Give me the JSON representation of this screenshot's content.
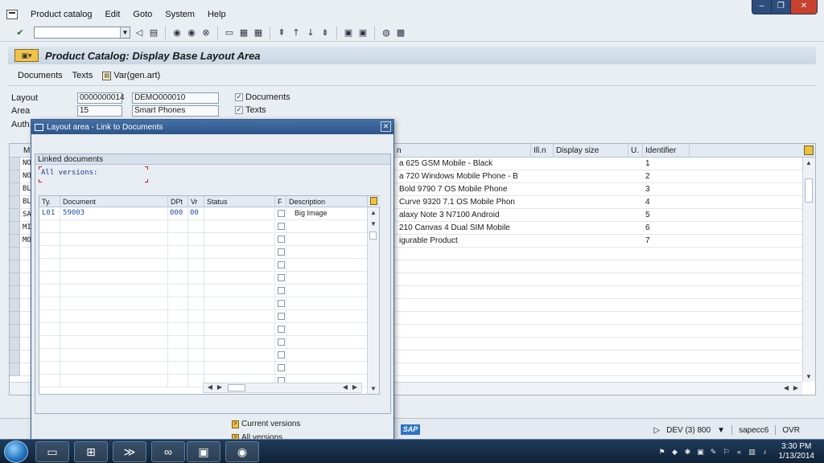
{
  "menubar": {
    "items": [
      "Product catalog",
      "Edit",
      "Goto",
      "System",
      "Help"
    ]
  },
  "page": {
    "title": "Product Catalog: Display Base Layout Area"
  },
  "app_toolbar": {
    "documents": "Documents",
    "texts": "Texts",
    "var": "Var(gen.art)"
  },
  "header": {
    "layout_label": "Layout",
    "layout_value": "0000000014",
    "layout_name": "DEMO000010",
    "area_label": "Area",
    "area_value": "15",
    "area_name": "Smart Phones",
    "auth_label": "Auth.",
    "documents_check": "Documents",
    "texts_check": "Texts"
  },
  "bg_table": {
    "columns": [
      "M",
      "n",
      "Ill.n",
      "Display size",
      "U.",
      "Identifier"
    ],
    "rows": [
      {
        "code": "NO",
        "text": "a 625 GSM Mobile - Black",
        "id": "1"
      },
      {
        "code": "NO",
        "text": "a 720 Windows Mobile Phone - B",
        "id": "2"
      },
      {
        "code": "BL",
        "text": "Bold 9790 7 OS Mobile Phone",
        "id": "3"
      },
      {
        "code": "BL",
        "text": "Curve 9320 7.1 OS Mobile Phon",
        "id": "4"
      },
      {
        "code": "SA",
        "text": "alaxy Note 3 N7100 Android",
        "id": "5"
      },
      {
        "code": "MI",
        "text": "210 Canvas 4 Dual SIM Mobile",
        "id": "6"
      },
      {
        "code": "MO",
        "text": "igurable Product",
        "id": "7"
      }
    ]
  },
  "dialog": {
    "title": "Layout area - Link to Documents",
    "group_title": "Linked documents",
    "all_versions_value": "All versions:",
    "columns": [
      "Ty.",
      "Document",
      "DPt",
      "Vr",
      "Status",
      "F",
      "Description"
    ],
    "rows": [
      {
        "type": "L01",
        "document": "59003",
        "dpt": "000",
        "vr": "00",
        "status": "",
        "description": "Big Image"
      }
    ],
    "current_versions": "Current versions",
    "all_versions_btn": "All versions"
  },
  "status": {
    "system": "DEV (3) 800",
    "server": "sapecc6",
    "mode": "OVR"
  },
  "taskbar": {
    "time": "3:30 PM",
    "date": "1/13/2014"
  },
  "colors": {
    "accent": "#2e5589",
    "sap_blue": "#2c74c4",
    "data_blue": "#1d4fa8"
  }
}
